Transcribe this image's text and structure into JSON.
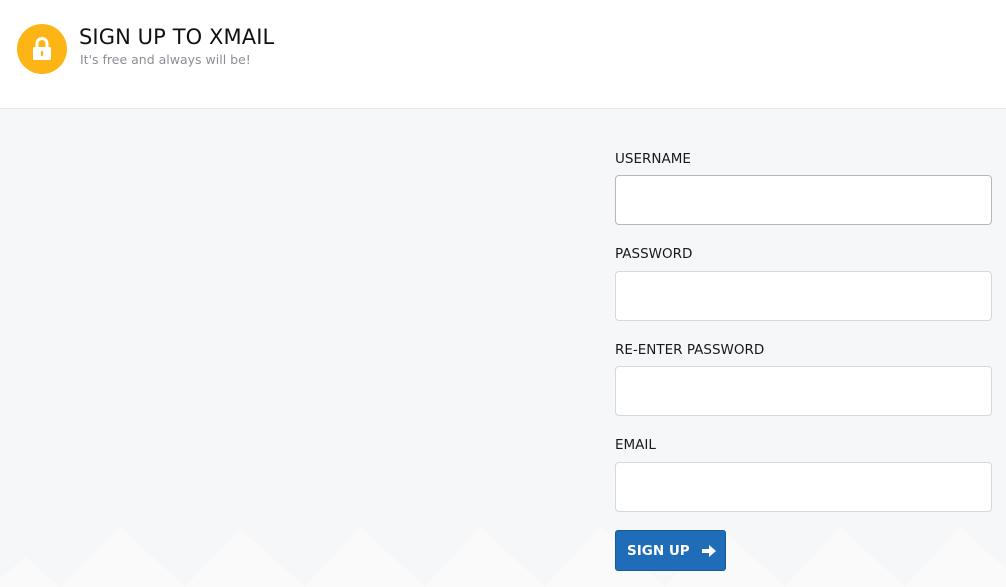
{
  "header": {
    "title": "SIGN UP TO XMAIL",
    "subtitle": "It's free and always will be!",
    "logo_icon": "lock-icon",
    "logo_color": "#fdb515"
  },
  "form": {
    "username": {
      "label": "USERNAME",
      "value": ""
    },
    "password": {
      "label": "PASSWORD",
      "value": ""
    },
    "reenter_password": {
      "label": "RE-ENTER PASSWORD",
      "value": ""
    },
    "email": {
      "label": "EMAIL",
      "value": ""
    },
    "submit": {
      "label": "SIGN UP",
      "icon": "arrow-right-icon",
      "color": "#1f6db8"
    }
  }
}
